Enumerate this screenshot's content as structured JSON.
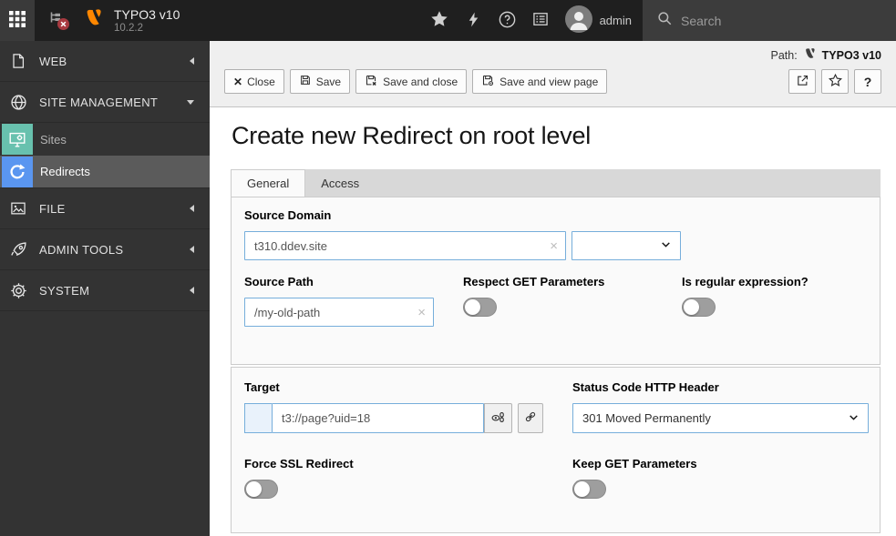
{
  "topbar": {
    "title": "TYPO3 v10",
    "version": "10.2.2",
    "username": "admin",
    "search_placeholder": "Search"
  },
  "sidebar": {
    "sections": [
      {
        "label": "WEB",
        "state": "collapsed"
      },
      {
        "label": "SITE MANAGEMENT",
        "state": "expanded",
        "children": [
          {
            "label": "Sites",
            "selected": false,
            "icon_color": "#68c1ae"
          },
          {
            "label": "Redirects",
            "selected": true,
            "icon_color": "#5a96f0"
          }
        ]
      },
      {
        "label": "FILE",
        "state": "collapsed"
      },
      {
        "label": "ADMIN TOOLS",
        "state": "collapsed"
      },
      {
        "label": "SYSTEM",
        "state": "collapsed"
      }
    ]
  },
  "docheader": {
    "path_label": "Path:",
    "path_value": "TYPO3 v10",
    "buttons": {
      "close": "Close",
      "save": "Save",
      "save_close": "Save and close",
      "save_view": "Save and view page"
    }
  },
  "page": {
    "title": "Create new Redirect on root level",
    "tabs": [
      {
        "label": "General",
        "active": true
      },
      {
        "label": "Access",
        "active": false
      }
    ]
  },
  "form": {
    "source_domain": {
      "label": "Source Domain",
      "value": "t310.ddev.site"
    },
    "source_domain_select": {
      "value": ""
    },
    "source_path": {
      "label": "Source Path",
      "value": "/my-old-path"
    },
    "respect_get": {
      "label": "Respect GET Parameters",
      "enabled": false
    },
    "is_regex": {
      "label": "Is regular expression?",
      "enabled": false
    },
    "target": {
      "label": "Target",
      "value": "t3://page?uid=18"
    },
    "status_code": {
      "label": "Status Code HTTP Header",
      "value": "301 Moved Permanently"
    },
    "force_ssl": {
      "label": "Force SSL Redirect",
      "enabled": false
    },
    "keep_get": {
      "label": "Keep GET Parameters",
      "enabled": false
    }
  },
  "icons": {
    "close": "✕",
    "clear": "×",
    "help": "?"
  },
  "colors": {
    "topbar_bg": "#1f1f1f",
    "sidebar_bg": "#333333",
    "selected_row_bg": "#5b5b5b",
    "typo3_orange": "#ff8700",
    "sites_icon_bg": "#68c1ae",
    "redirects_icon_bg": "#5a96f0",
    "input_border": "#76aedb",
    "panel_bg": "#fafafa"
  }
}
